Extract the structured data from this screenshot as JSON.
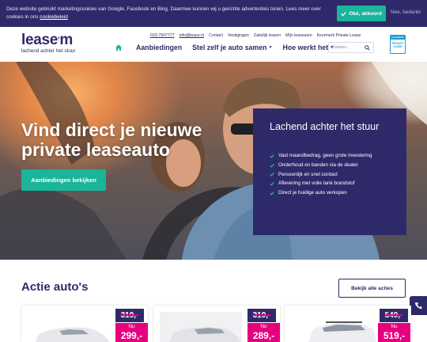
{
  "cookie": {
    "text": "Deze website gebruikt marketingcookies van Google, Facebook en Bing. Daarmee kunnen wij u gerichte advertenties tonen. Lees meer over cookies in ons ",
    "link": "cookiebeleid",
    "accept_label": "Oké, akkoord",
    "decline_label": "Nee, bedankt"
  },
  "header": {
    "logo_word": "lease",
    "logo_mark": "m",
    "tagline": "lachend achter het stuur",
    "toplinks": [
      "033-7507777",
      "info@lease.nl",
      "Contact",
      "Vestigingen",
      "Zakelijk leasen",
      "Mijn leaseauto",
      "Keurmerk Private Lease"
    ],
    "nav": [
      {
        "label": "Aanbiedingen",
        "dropdown": false
      },
      {
        "label": "Stel zelf je auto samen",
        "dropdown": true
      },
      {
        "label": "Hoe werkt het",
        "dropdown": true
      }
    ],
    "search_placeholder": "Zoeken..",
    "badge": {
      "top": "KEURMERK",
      "text": "PRIVATE LEASE"
    }
  },
  "hero": {
    "title": "Vind direct je nieuwe private leaseauto",
    "cta": "Aanbiedingen bekijken",
    "panel_title": "Lachend achter het stuur",
    "usps": [
      "Vast maandbedrag, geen grote investering",
      "Onderhoud en banden via de dealer",
      "Persoonlijk en snel contact",
      "Aflevering met volle tank brandstof",
      "Direct je huidige auto verkopen"
    ]
  },
  "actie": {
    "title": "Actie auto's",
    "all_label": "Bekijk alle acties",
    "cards": [
      {
        "old_price": "319,-",
        "now_label": "Nu",
        "new_price": "299,-"
      },
      {
        "old_price": "319,-",
        "now_label": "Nu",
        "new_price": "289,-"
      },
      {
        "old_price": "549,-",
        "now_label": "Nu",
        "new_price": "519,-"
      }
    ]
  },
  "colors": {
    "brand": "#2e2a6a",
    "accent": "#1ab59a",
    "pink": "#e6007e"
  }
}
